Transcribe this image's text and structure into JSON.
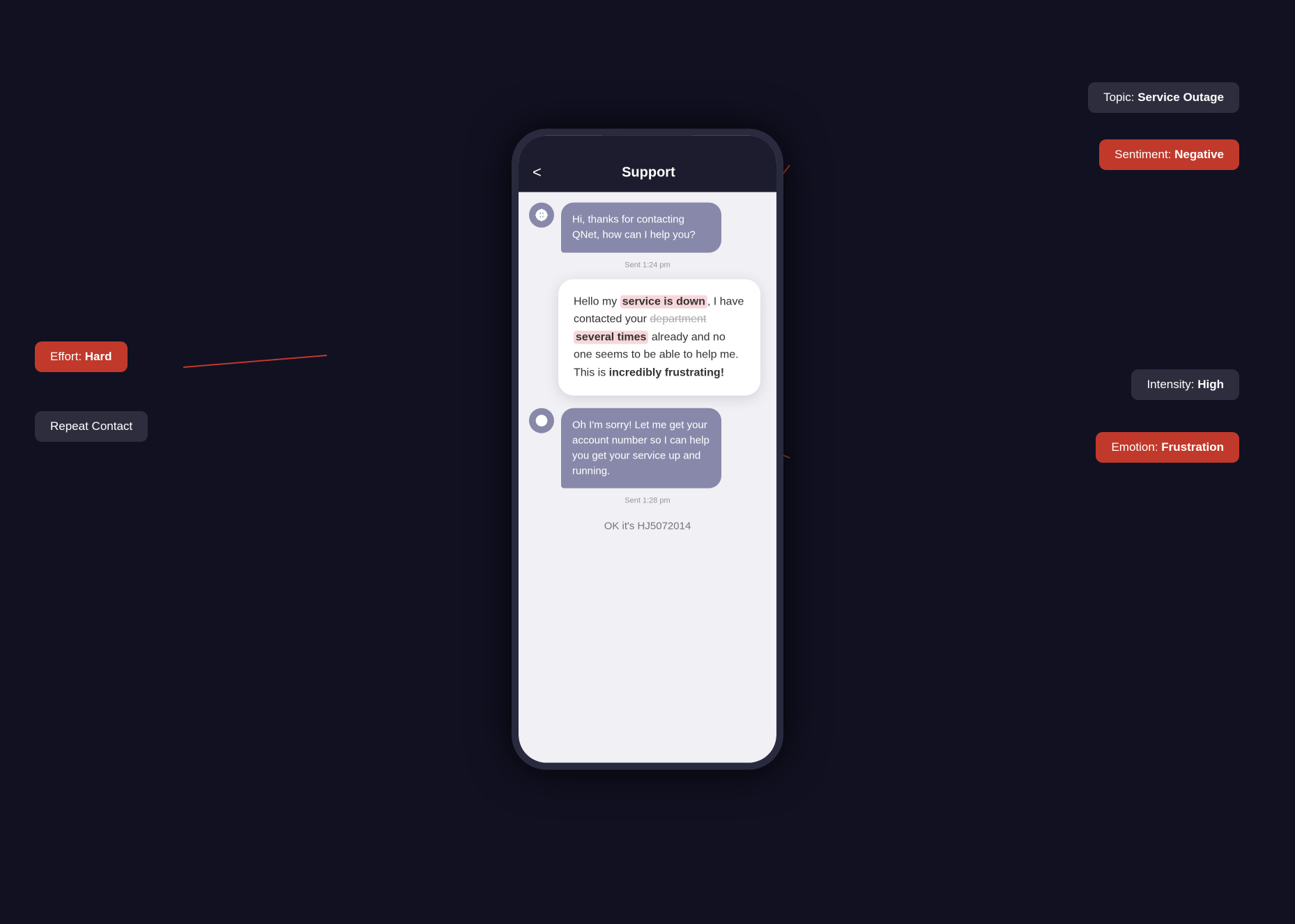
{
  "page": {
    "background": "#0d0d1a"
  },
  "phone": {
    "header": {
      "back": "<",
      "title": "Support"
    },
    "messages": [
      {
        "type": "bot",
        "text": "Hi, thanks for contacting QNet, how can I help you?",
        "timestamp": "Sent 1:24 pm"
      },
      {
        "type": "user",
        "parts": [
          {
            "text": "Hello my ",
            "style": "normal"
          },
          {
            "text": "service is down",
            "style": "highlight"
          },
          {
            "text": ", I have contacted your ",
            "style": "normal"
          },
          {
            "text": "department",
            "style": "strikethrough"
          },
          {
            "text": " ",
            "style": "normal"
          },
          {
            "text": "several times",
            "style": "highlight"
          },
          {
            "text": " already and no one seems to be able to help me. This is ",
            "style": "normal"
          },
          {
            "text": "incredibly frustrating!",
            "style": "bold"
          }
        ]
      },
      {
        "type": "bot",
        "text": "Oh I'm sorry! Let me get your account number so I can help you get your service up and running.",
        "timestamp": "Sent 1:28 pm"
      },
      {
        "type": "user-partial",
        "text": "OK it's HJ5072014"
      }
    ]
  },
  "badges": {
    "topic": {
      "label": "Topic: ",
      "value": "Service Outage",
      "style": "dark"
    },
    "sentiment": {
      "label": "Sentiment: ",
      "value": "Negative",
      "style": "red"
    },
    "intensity": {
      "label": "Intensity: ",
      "value": "High",
      "style": "dark"
    },
    "emotion": {
      "label": "Emotion: ",
      "value": "Frustration",
      "style": "red"
    },
    "effort": {
      "label": "Effort: ",
      "value": "Hard",
      "style": "red"
    },
    "repeat_contact": {
      "label": "Repeat Contact",
      "style": "dark"
    }
  }
}
